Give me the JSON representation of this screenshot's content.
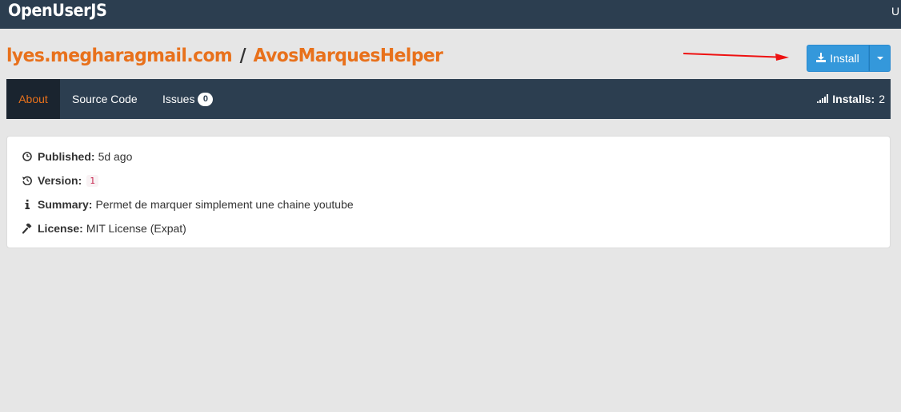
{
  "topbar": {
    "brand": "OpenUserJS",
    "right_text": "U"
  },
  "header": {
    "author": "lyes.megharagmail.com",
    "separator": "/",
    "script_name": "AvosMarquesHelper"
  },
  "install": {
    "label": "Install",
    "icon": "download-icon",
    "caret_icon": "caret-down-icon"
  },
  "tabs": [
    {
      "label": "About",
      "active": true
    },
    {
      "label": "Source Code",
      "active": false
    },
    {
      "label": "Issues",
      "active": false,
      "badge": "0"
    }
  ],
  "stats": {
    "installs_label": "Installs:",
    "installs_value": "2",
    "icon": "signal-bars-icon"
  },
  "details": {
    "published_label": "Published:",
    "published_value": "5d ago",
    "version_label": "Version:",
    "version_value": "1",
    "summary_label": "Summary:",
    "summary_value": "Permet de marquer simplement une chaine youtube",
    "license_label": "License:",
    "license_value": "MIT License (Expat)"
  },
  "colors": {
    "navbar": "#2c3e50",
    "accent_orange": "#e8711c",
    "install_blue": "#3498db",
    "annotation_arrow": "#ee1111",
    "page_background": "#e6e6e6"
  }
}
